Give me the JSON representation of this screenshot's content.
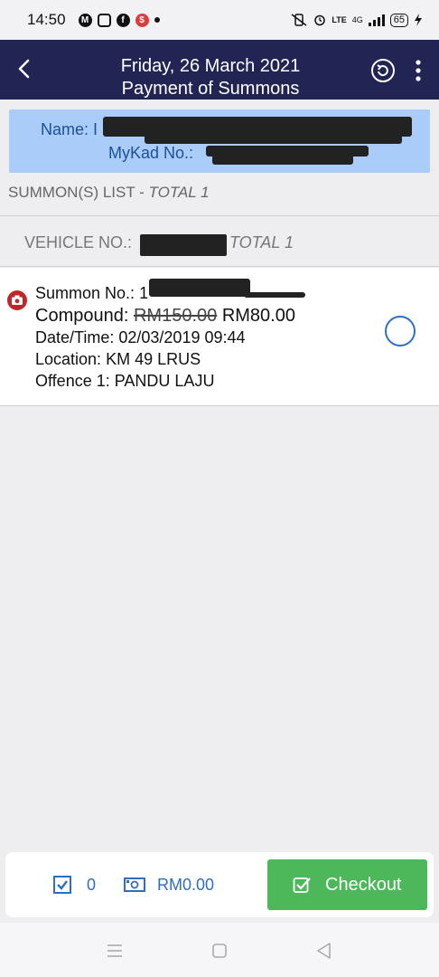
{
  "status_bar": {
    "time": "14:50",
    "left_icons": [
      "mail-icon",
      "messenger-icon",
      "facebook-icon",
      "dollar-icon"
    ],
    "lte": "LTE",
    "net": "4G",
    "battery": "65"
  },
  "header": {
    "date": "Friday, 26 March 2021",
    "title": "Payment of Summons"
  },
  "profile": {
    "name_label": "Name: I",
    "mykad_label": "MyKad No.: "
  },
  "list": {
    "title": "SUMMON(S) LIST",
    "separator": " - ",
    "total": "TOTAL 1",
    "vehicle_label": "VEHICLE NO.:",
    "vehicle_total": "TOTAL 1"
  },
  "summon": {
    "number_label": "Summon No.:",
    "number_partial": "1",
    "compound_label": "Compound:",
    "original_amount": "RM150.00",
    "discounted_amount": "RM80.00",
    "datetime_label": "Date/Time:",
    "datetime": "02/03/2019 09:44",
    "location_label": "Location:",
    "location": "KM 49 LRUS",
    "offence_label": "Offence 1:",
    "offence": "PANDU LAJU",
    "selected": false
  },
  "footer": {
    "selected_count": "0",
    "total_amount": "RM0.00",
    "checkout_label": "Checkout"
  },
  "colors": {
    "header_bg": "#222554",
    "profile_bg": "#a9cdf8",
    "accent_blue": "#2f6fbf",
    "checkout_green": "#4cb859"
  }
}
